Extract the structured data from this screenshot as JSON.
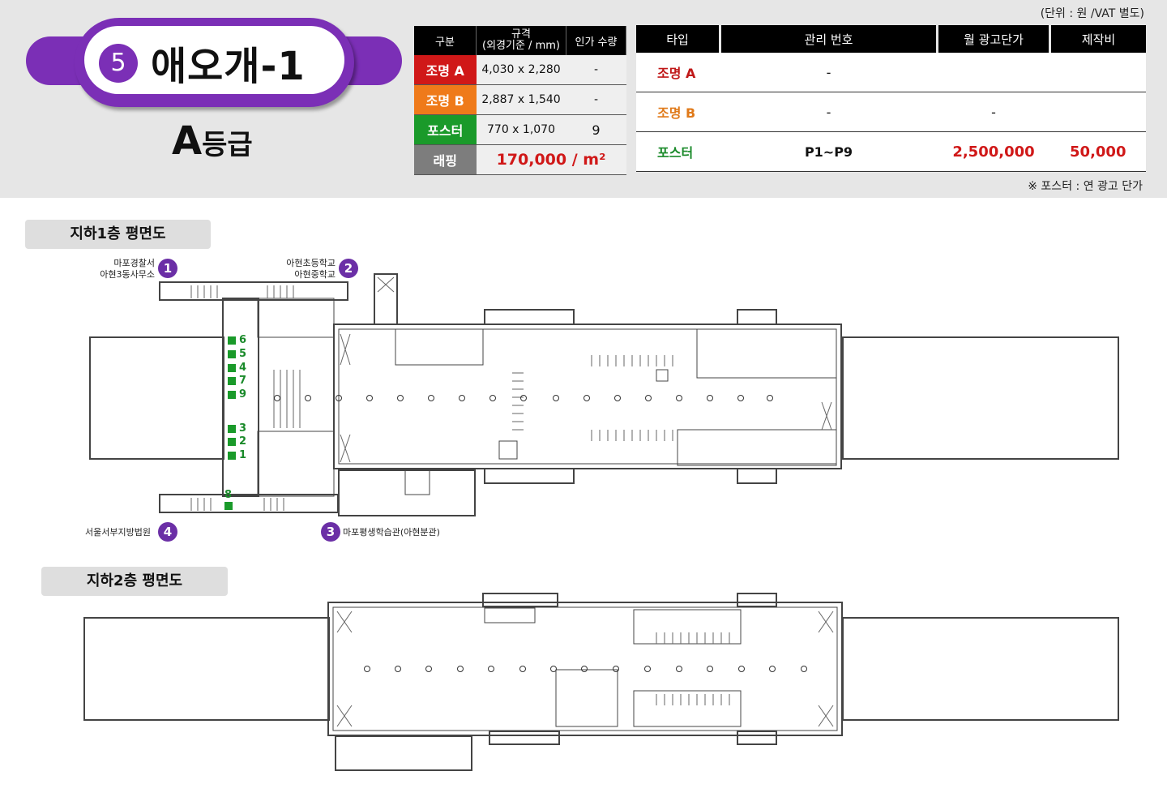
{
  "header": {
    "unit_note": "(단위 : 원 /VAT 별도)",
    "station_number": "5",
    "station_name": "애오개-1",
    "grade_letter": "A",
    "grade_suffix": "등급",
    "poster_note": "※ 포스터 : 연 광고 단가"
  },
  "spec_table": {
    "headers": [
      "구분",
      "규격",
      "(외경기준 / mm)",
      "인가 수량"
    ],
    "rows": [
      {
        "label": "조명 A",
        "size": "4,030 x 2,280",
        "qty": "-"
      },
      {
        "label": "조명 B",
        "size": "2,887 x 1,540",
        "qty": "-"
      },
      {
        "label": "포스터",
        "size": "770 x 1,070",
        "qty": "9"
      }
    ],
    "wrap_label": "래핑",
    "wrap_value": "170,000 / m²"
  },
  "price_table": {
    "headers": [
      "타입",
      "관리 번호",
      "월 광고단가",
      "제작비"
    ],
    "rows": [
      {
        "type": "조명 A",
        "code": "-",
        "price": "",
        "cost": ""
      },
      {
        "type": "조명 B",
        "code": "-",
        "price": "-",
        "cost": ""
      },
      {
        "type": "포스터",
        "code": "P1~P9",
        "price": "2,500,000",
        "cost": "50,000"
      }
    ]
  },
  "floor_b1": {
    "label": "지하1층 평면도",
    "exits": [
      {
        "num": "1",
        "line1": "마포경찰서",
        "line2": "아현3동사무소"
      },
      {
        "num": "2",
        "line1": "아현초등학교",
        "line2": "아현중학교"
      },
      {
        "num": "3",
        "line1": "마포평생학습관(아현분관)",
        "line2": ""
      },
      {
        "num": "4",
        "line1": "서울서부지방법원",
        "line2": ""
      }
    ],
    "posters": [
      "6",
      "5",
      "4",
      "7",
      "9",
      "3",
      "2",
      "1",
      "8"
    ]
  },
  "floor_b2": {
    "label": "지하2층 평면도"
  },
  "colors": {
    "purple": "#7b2fb6",
    "light_a": "#d01818",
    "light_b": "#ef7a1a",
    "poster": "#1a9a2a",
    "wrap": "#7d7d7d"
  }
}
